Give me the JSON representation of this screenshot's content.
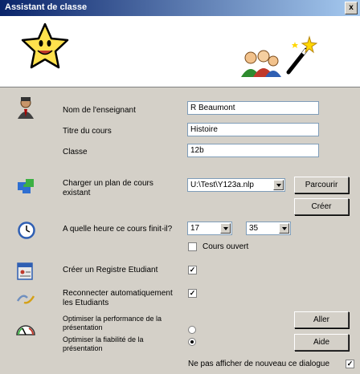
{
  "window": {
    "title": "Assistant de classe",
    "close_label": "x"
  },
  "form": {
    "teacher_label": "Nom de l'enseignant",
    "teacher_value": "R Beaumont",
    "course_title_label": "Titre du cours",
    "course_title_value": "Histoire",
    "class_label": "Classe",
    "class_value": "12b",
    "load_plan_label": "Charger un plan de cours existant",
    "plan_path_value": "U:\\Test\\Y123a.nlp",
    "browse_label": "Parcourir",
    "create_label": "Créer",
    "end_time_label": "A quelle heure ce cours finit-il?",
    "hour_value": "17",
    "minute_value": "35",
    "open_course_label": "Cours ouvert",
    "create_register_label": "Créer un Registre Etudiant",
    "reconnect_label": "Reconnecter automatiquement les Etudiants",
    "optimize_performance_label": "Optimiser la performance de la présentation",
    "optimize_reliability_label": "Optimiser la fiabilité de la présentation",
    "go_label": "Aller",
    "help_label": "Aide",
    "dont_show_label": "Ne pas afficher de nouveau ce dialogue"
  },
  "state": {
    "open_course_checked": false,
    "create_register_checked": true,
    "reconnect_checked": true,
    "optimize_mode": "reliability",
    "dont_show_checked": true
  },
  "icons": [
    "star-mascot-icon",
    "people-icon",
    "magic-wand-icon",
    "teacher-icon",
    "puzzle-icon",
    "clock-icon",
    "register-icon",
    "reconnect-icon",
    "gauge-icon"
  ]
}
